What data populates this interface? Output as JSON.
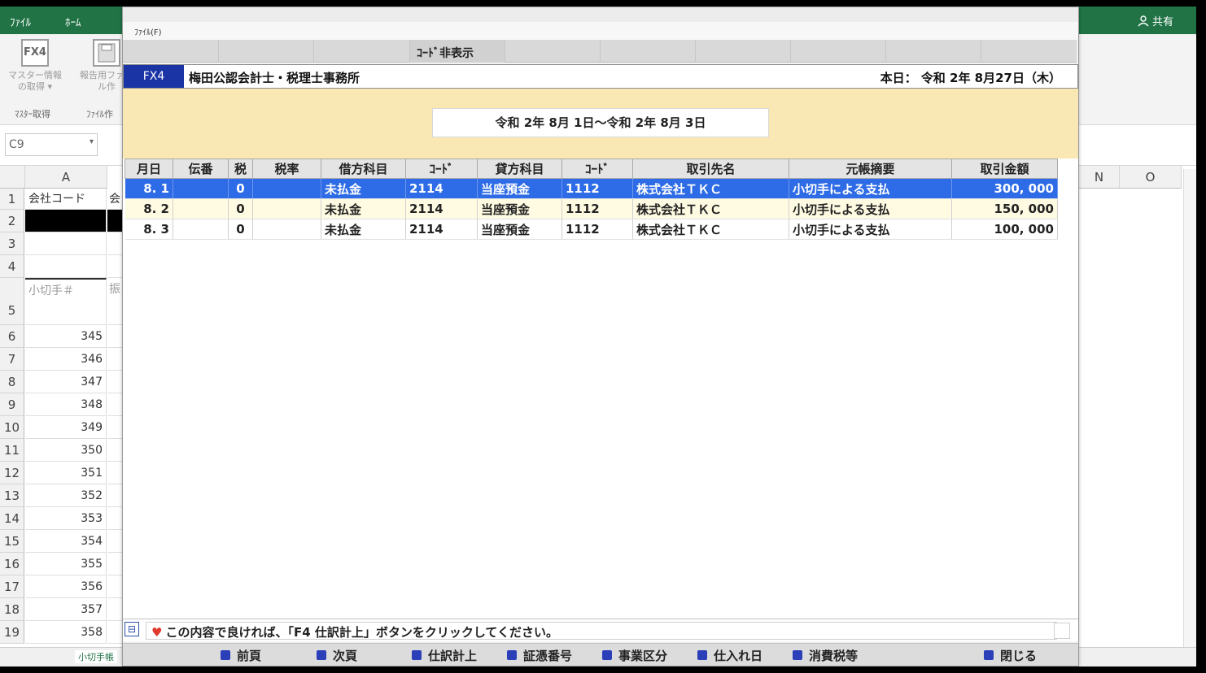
{
  "excel": {
    "tabs": [
      "ﾌｧｲﾙ",
      "ﾎｰﾑ"
    ],
    "share_label": "共有",
    "ribbon": {
      "btn1_icon_text": "FX4",
      "btn1_label": "マスター情報の取得 ▾",
      "btn2_label": "報告用ファイル作",
      "group1": "ﾏｽﾀｰ取得",
      "group2": "ﾌｧｲﾙ作"
    },
    "name_box": "C9",
    "col_a": "A",
    "col_n": "N",
    "col_o": "O",
    "rows": [
      {
        "num": "1",
        "a": "会社コード",
        "b": "会"
      },
      {
        "num": "2",
        "a": "",
        "b": ""
      },
      {
        "num": "3",
        "a": "",
        "b": ""
      },
      {
        "num": "4",
        "a": "",
        "b": ""
      },
      {
        "num": "5",
        "a": "小切手＃",
        "b": "振"
      },
      {
        "num": "6",
        "a": "345",
        "b": ""
      },
      {
        "num": "7",
        "a": "346",
        "b": ""
      },
      {
        "num": "8",
        "a": "347",
        "b": ""
      },
      {
        "num": "9",
        "a": "348",
        "b": ""
      },
      {
        "num": "10",
        "a": "349",
        "b": ""
      },
      {
        "num": "11",
        "a": "350",
        "b": ""
      },
      {
        "num": "12",
        "a": "351",
        "b": ""
      },
      {
        "num": "13",
        "a": "352",
        "b": ""
      },
      {
        "num": "14",
        "a": "353",
        "b": ""
      },
      {
        "num": "15",
        "a": "354",
        "b": ""
      },
      {
        "num": "16",
        "a": "355",
        "b": ""
      },
      {
        "num": "17",
        "a": "356",
        "b": ""
      },
      {
        "num": "18",
        "a": "357",
        "b": ""
      },
      {
        "num": "19",
        "a": "358",
        "b": ""
      }
    ],
    "sheet_tab": "小切手帳"
  },
  "dialog": {
    "menu_file": "ﾌｧｲﾙ(F)",
    "fn_code_hide": "ｺｰﾄﾞ非表示",
    "logo": "FX4",
    "firm_name": "梅田公認会計士・税理士事務所",
    "today": "本日： 令和 2年 8月27日（木）",
    "period": "令和 2年 8月 1日～令和 2年 8月 3日",
    "columns": [
      "月日",
      "伝番",
      "税",
      "税率",
      "借方科目",
      "ｺｰﾄﾞ",
      "貸方科目",
      "ｺｰﾄﾞ",
      "取引先名",
      "元帳摘要",
      "取引金額"
    ],
    "rows": [
      {
        "date": "8. 1",
        "den": "",
        "tax": "0",
        "rate": "",
        "debit": "未払金",
        "debit_code": "2114",
        "credit": "当座預金",
        "credit_code": "1112",
        "partner": "株式会社ＴＫＣ",
        "memo": "小切手による支払",
        "amount": "300, 000"
      },
      {
        "date": "8. 2",
        "den": "",
        "tax": "0",
        "rate": "",
        "debit": "未払金",
        "debit_code": "2114",
        "credit": "当座預金",
        "credit_code": "1112",
        "partner": "株式会社ＴＫＣ",
        "memo": "小切手による支払",
        "amount": "150, 000"
      },
      {
        "date": "8. 3",
        "den": "",
        "tax": "0",
        "rate": "",
        "debit": "未払金",
        "debit_code": "2114",
        "credit": "当座預金",
        "credit_code": "1112",
        "partner": "株式会社ＴＫＣ",
        "memo": "小切手による支払",
        "amount": "100, 000"
      }
    ],
    "message": "この内容で良ければ、「F4 仕訳計上」ボタンをクリックしてください。",
    "buttons": {
      "prev": "前頁",
      "next": "次頁",
      "post": "仕訳計上",
      "voucher": "証憑番号",
      "biz": "事業区分",
      "purchase_date": "仕入れ日",
      "consumption_tax": "消費税等",
      "close": "閉じる"
    },
    "colors": {
      "selected_row": "#2e6be6",
      "band": "#fae8b4",
      "logo": "#1a34a6"
    }
  }
}
